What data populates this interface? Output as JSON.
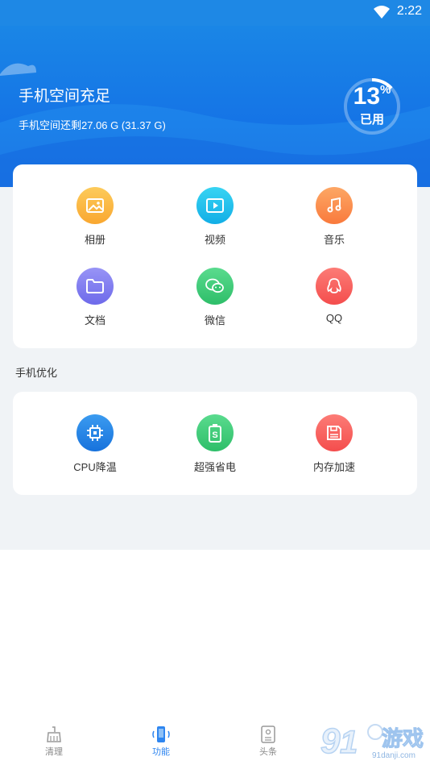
{
  "status_bar": {
    "time": "2:22"
  },
  "storage": {
    "title": "手机空间充足",
    "detail": "手机空间还剩27.06 G (31.37 G)",
    "used_percent": 13,
    "percent_sign": "%",
    "used_label": "已用"
  },
  "file_categories": [
    {
      "label": "相册",
      "icon": "photo-album-icon",
      "color": "#FBB542"
    },
    {
      "label": "视频",
      "icon": "video-icon",
      "color": "#20C0EC"
    },
    {
      "label": "音乐",
      "icon": "music-icon",
      "color": "#FB8E4C"
    },
    {
      "label": "文档",
      "icon": "folder-icon",
      "color": "#7E7BF0"
    },
    {
      "label": "微信",
      "icon": "wechat-icon",
      "color": "#3DCB78"
    },
    {
      "label": "QQ",
      "icon": "qq-icon",
      "color": "#F8605E"
    }
  ],
  "optimize": {
    "title": "手机优化",
    "items": [
      {
        "label": "CPU降温",
        "icon": "cpu-icon",
        "color": "#1F86E6"
      },
      {
        "label": "超强省电",
        "icon": "battery-icon",
        "color": "#3DCB78"
      },
      {
        "label": "内存加速",
        "icon": "memory-card-icon",
        "color": "#F8605E"
      }
    ]
  },
  "tabs": [
    {
      "label": "清理",
      "icon": "broom-icon",
      "active": false
    },
    {
      "label": "功能",
      "icon": "phone-function-icon",
      "active": true
    },
    {
      "label": "头条",
      "icon": "news-icon",
      "active": false
    }
  ],
  "watermark": {
    "brand": "游戏",
    "number": "9",
    "url": "91danji.com"
  }
}
